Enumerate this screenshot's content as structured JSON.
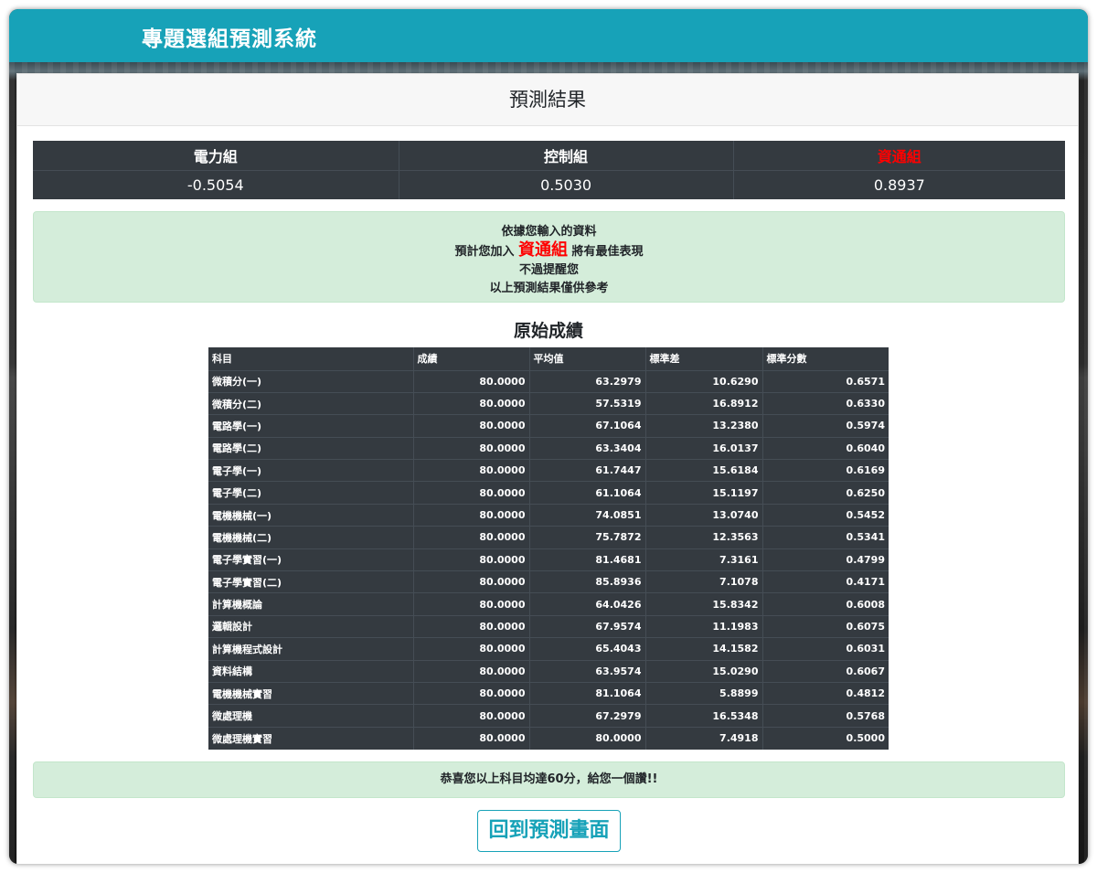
{
  "app": {
    "title": "專題選組預測系統"
  },
  "card": {
    "header": "預測結果"
  },
  "prediction": {
    "groups": [
      {
        "name": "電力組",
        "score": "-0.5054",
        "highlight": false
      },
      {
        "name": "控制組",
        "score": "0.5030",
        "highlight": false
      },
      {
        "name": "資通組",
        "score": "0.8937",
        "highlight": true
      }
    ]
  },
  "message": {
    "line1": "依據您輸入的資料",
    "line2_prefix": "預計您加入",
    "recommended": "資通組",
    "line2_suffix": "將有最佳表現",
    "line3": "不過提醒您",
    "line4": "以上預測結果僅供參考"
  },
  "grades": {
    "title": "原始成績",
    "headers": [
      "科目",
      "成績",
      "平均值",
      "標準差",
      "標準分數"
    ],
    "rows": [
      [
        "微積分(一)",
        "80.0000",
        "63.2979",
        "10.6290",
        "0.6571"
      ],
      [
        "微積分(二)",
        "80.0000",
        "57.5319",
        "16.8912",
        "0.6330"
      ],
      [
        "電路學(一)",
        "80.0000",
        "67.1064",
        "13.2380",
        "0.5974"
      ],
      [
        "電路學(二)",
        "80.0000",
        "63.3404",
        "16.0137",
        "0.6040"
      ],
      [
        "電子學(一)",
        "80.0000",
        "61.7447",
        "15.6184",
        "0.6169"
      ],
      [
        "電子學(二)",
        "80.0000",
        "61.1064",
        "15.1197",
        "0.6250"
      ],
      [
        "電機機械(一)",
        "80.0000",
        "74.0851",
        "13.0740",
        "0.5452"
      ],
      [
        "電機機械(二)",
        "80.0000",
        "75.7872",
        "12.3563",
        "0.5341"
      ],
      [
        "電子學實習(一)",
        "80.0000",
        "81.4681",
        "7.3161",
        "0.4799"
      ],
      [
        "電子學實習(二)",
        "80.0000",
        "85.8936",
        "7.1078",
        "0.4171"
      ],
      [
        "計算機概論",
        "80.0000",
        "64.0426",
        "15.8342",
        "0.6008"
      ],
      [
        "邏輯設計",
        "80.0000",
        "67.9574",
        "11.1983",
        "0.6075"
      ],
      [
        "計算機程式設計",
        "80.0000",
        "65.4043",
        "14.1582",
        "0.6031"
      ],
      [
        "資料結構",
        "80.0000",
        "63.9574",
        "15.0290",
        "0.6067"
      ],
      [
        "電機機械實習",
        "80.0000",
        "81.1064",
        "5.8899",
        "0.4812"
      ],
      [
        "微處理機",
        "80.0000",
        "67.2979",
        "16.5348",
        "0.5768"
      ],
      [
        "微處理機實習",
        "80.0000",
        "80.0000",
        "7.4918",
        "0.5000"
      ]
    ]
  },
  "congrats": "恭喜您以上科目均達60分，給您一個讚!!",
  "back_button": "回到預測畫面",
  "colors": {
    "navbar": "#17a2b8",
    "highlight": "#ff0000",
    "alert_bg": "#d4edda",
    "table_bg": "#343a40"
  }
}
